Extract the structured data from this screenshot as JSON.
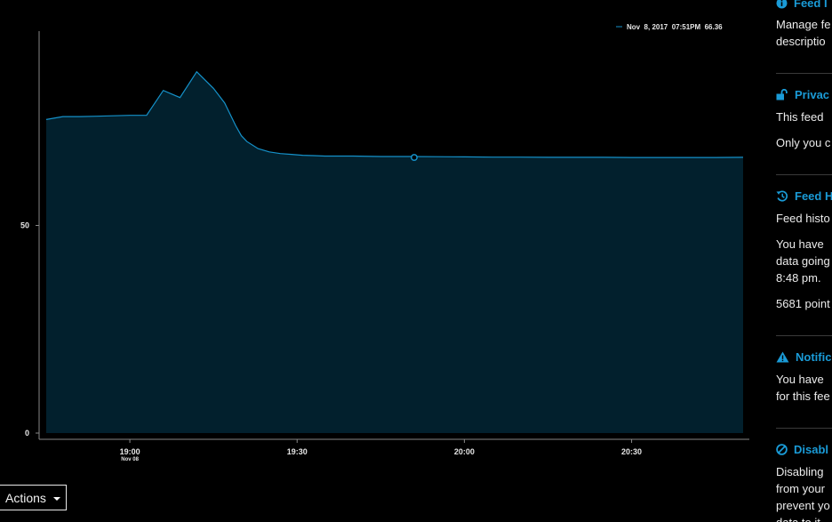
{
  "chart_data": {
    "type": "area",
    "series": [
      {
        "x": [
          "18:45",
          "18:48",
          "18:51",
          "18:54",
          "18:57",
          "19:00",
          "19:03",
          "19:06",
          "19:09",
          "19:12",
          "19:15",
          "19:17",
          "19:19",
          "19:20",
          "19:21",
          "19:23",
          "19:25",
          "19:27",
          "19:29",
          "19:31",
          "19:33",
          "19:35",
          "19:40",
          "19:45",
          "19:50",
          "19:55",
          "20:00",
          "20:05",
          "20:10",
          "20:15",
          "20:20",
          "20:25",
          "20:30",
          "20:35",
          "20:40",
          "20:45",
          "20:50"
        ],
        "values": [
          75.5,
          76.2,
          76.2,
          76.3,
          76.4,
          76.5,
          76.5,
          82.5,
          80.8,
          87.0,
          83.0,
          79.5,
          74.0,
          71.6,
          70.2,
          68.5,
          67.7,
          67.3,
          67.1,
          66.9,
          66.8,
          66.7,
          66.7,
          66.6,
          66.6,
          66.55,
          66.5,
          66.45,
          66.45,
          66.4,
          66.4,
          66.4,
          66.35,
          66.35,
          66.35,
          66.35,
          66.4
        ]
      }
    ],
    "x_ticks": [
      {
        "label": "19:00",
        "sub": "Nov 08"
      },
      {
        "label": "19:30",
        "sub": ""
      },
      {
        "label": "20:00",
        "sub": ""
      },
      {
        "label": "20:30",
        "sub": ""
      }
    ],
    "y_ticks": [
      "0",
      "50"
    ],
    "ylim": [
      0,
      100
    ],
    "legend_text": "Nov  8, 2017  07:51PM  66.36",
    "legend_position": "top-right",
    "marker": {
      "x": "19:51",
      "value": 66.36
    },
    "line_color": "#1591c9",
    "fill_color": "#02202d",
    "axis_color": "#888888"
  },
  "actions": {
    "label": "Actions"
  },
  "sidebar": {
    "feed_info": {
      "title": "Feed I",
      "icon": "info-icon",
      "lines": [
        "Manage fe",
        "descriptio"
      ]
    },
    "privacy": {
      "title": "Privac",
      "icon": "unlock-icon",
      "lines": [
        "This feed",
        "Only you c"
      ]
    },
    "history": {
      "title": "Feed H",
      "icon": "history-icon",
      "lines": [
        "Feed histo",
        "You have",
        "data going",
        "8:48 pm.",
        "5681 point"
      ]
    },
    "notifications": {
      "title": "Notific",
      "icon": "warning-icon",
      "lines": [
        "You have",
        "for this fee"
      ]
    },
    "disable": {
      "title": "Disabl",
      "icon": "disable-icon",
      "lines": [
        "Disabling",
        "from your",
        "prevent yo",
        "data to it"
      ]
    },
    "accent_color": "#1a9bd7"
  }
}
